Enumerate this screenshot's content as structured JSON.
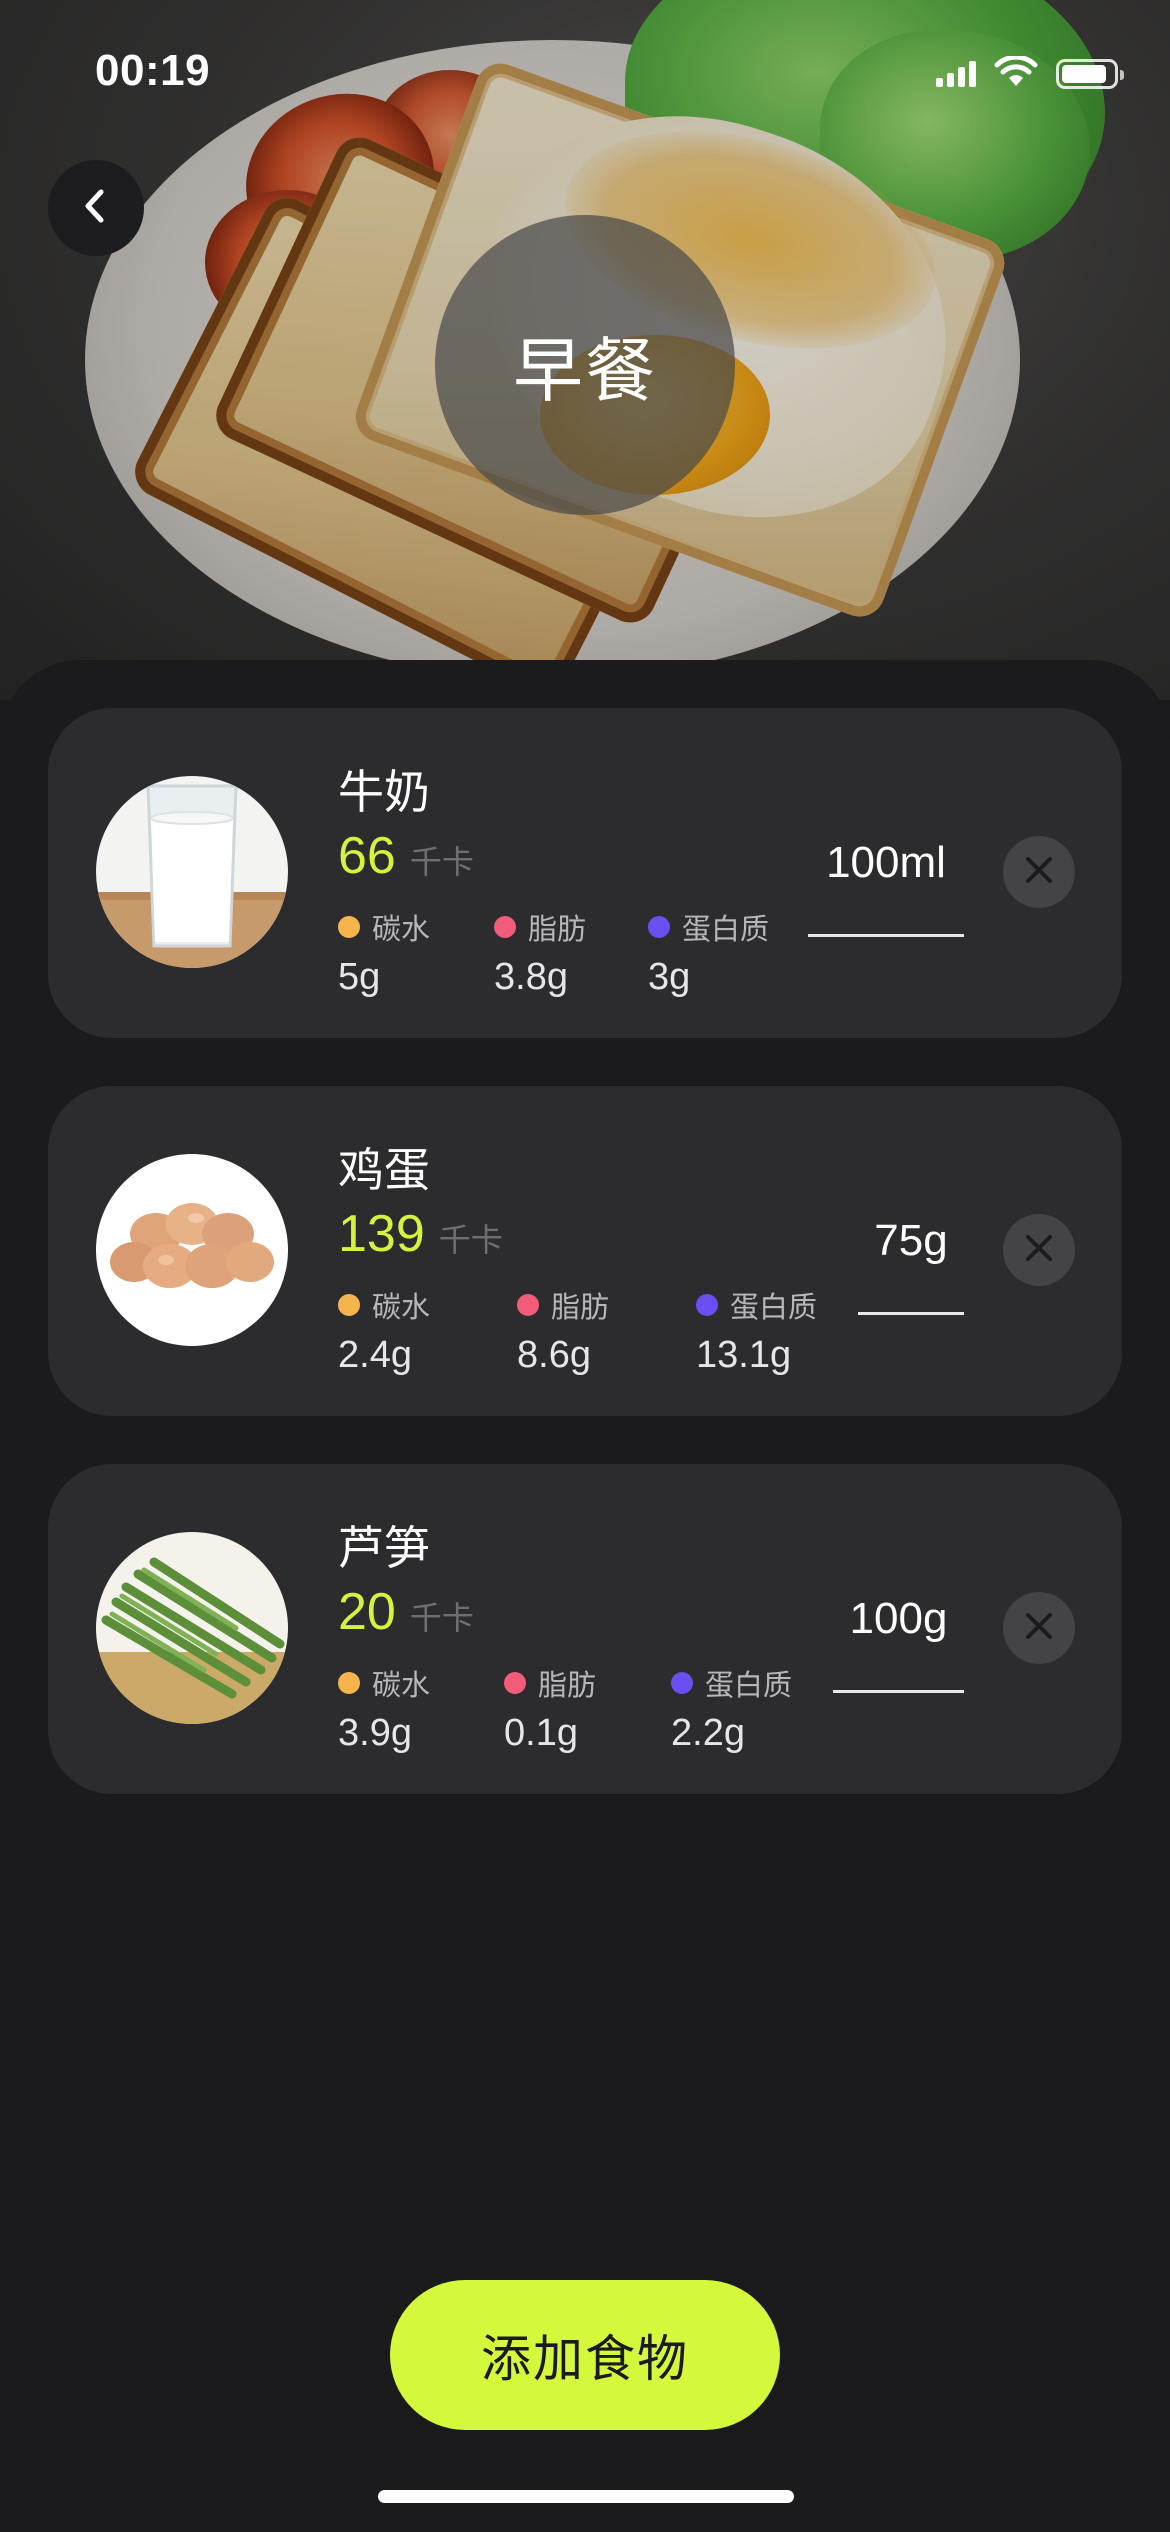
{
  "status_bar": {
    "time": "00:19",
    "icons": [
      "signal-icon",
      "wifi-icon",
      "battery-icon"
    ]
  },
  "header": {
    "back_icon": "chevron-left-icon",
    "title": "早餐"
  },
  "foods": [
    {
      "name": "牛奶",
      "image": "milk-glass",
      "kcal": "66",
      "kcal_unit": "千卡",
      "nutrients": [
        {
          "label": "碳水",
          "value": "5g",
          "color": "#f5b54c"
        },
        {
          "label": "脂肪",
          "value": "3.8g",
          "color": "#f25b7a"
        },
        {
          "label": "蛋白质",
          "value": "3g",
          "color": "#6a4ef0"
        }
      ],
      "amount": "100ml"
    },
    {
      "name": "鸡蛋",
      "image": "eggs",
      "kcal": "139",
      "kcal_unit": "千卡",
      "nutrients": [
        {
          "label": "碳水",
          "value": "2.4g",
          "color": "#f5b54c"
        },
        {
          "label": "脂肪",
          "value": "8.6g",
          "color": "#f25b7a"
        },
        {
          "label": "蛋白质",
          "value": "13.1g",
          "color": "#6a4ef0"
        }
      ],
      "amount": "75g"
    },
    {
      "name": "芦笋",
      "image": "asparagus",
      "kcal": "20",
      "kcal_unit": "千卡",
      "nutrients": [
        {
          "label": "碳水",
          "value": "3.9g",
          "color": "#f5b54c"
        },
        {
          "label": "脂肪",
          "value": "0.1g",
          "color": "#f25b7a"
        },
        {
          "label": "蛋白质",
          "value": "2.2g",
          "color": "#6a4ef0"
        }
      ],
      "amount": "100g"
    }
  ],
  "remove_icon": "close-icon",
  "add_button": {
    "label": "添加食物"
  },
  "colors": {
    "accent": "#d4f83c",
    "kcal": "#d6f23c",
    "background": "#1b1b1d",
    "card": "#2c2c2e"
  }
}
